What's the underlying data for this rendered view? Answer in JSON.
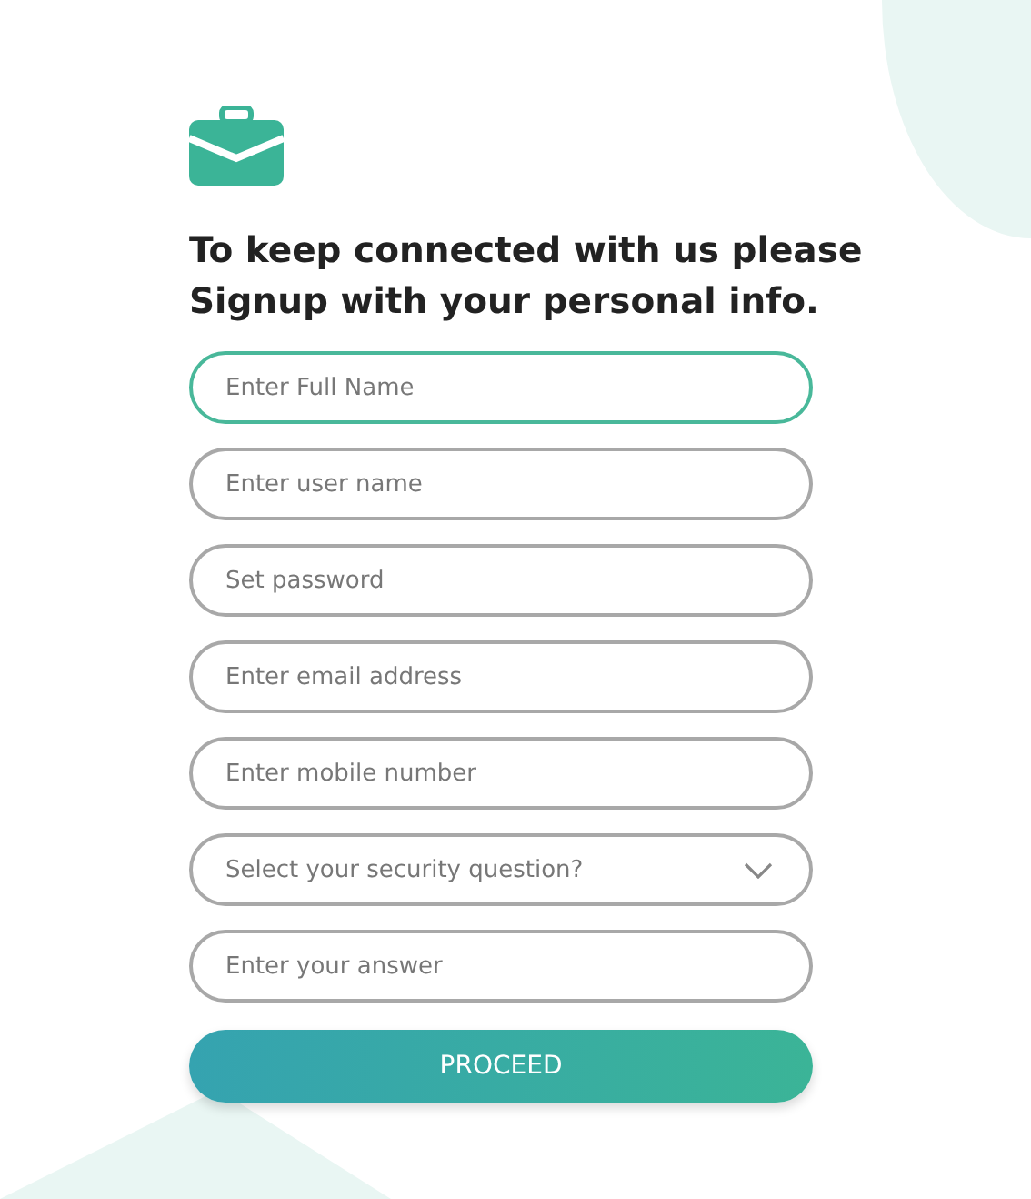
{
  "heading": "To keep connected with us please Signup with your personal info.",
  "fields": [
    {
      "kind": "text",
      "placeholder": "Enter Full Name",
      "focused": true
    },
    {
      "kind": "text",
      "placeholder": "Enter user name",
      "focused": false
    },
    {
      "kind": "text",
      "placeholder": "Set password",
      "focused": false
    },
    {
      "kind": "text",
      "placeholder": "Enter email address",
      "focused": false
    },
    {
      "kind": "text",
      "placeholder": "Enter mobile number",
      "focused": false
    },
    {
      "kind": "select",
      "placeholder": "Select your security question?",
      "focused": false
    },
    {
      "kind": "text",
      "placeholder": "Enter your answer",
      "focused": false
    }
  ],
  "button": "PROCEED"
}
